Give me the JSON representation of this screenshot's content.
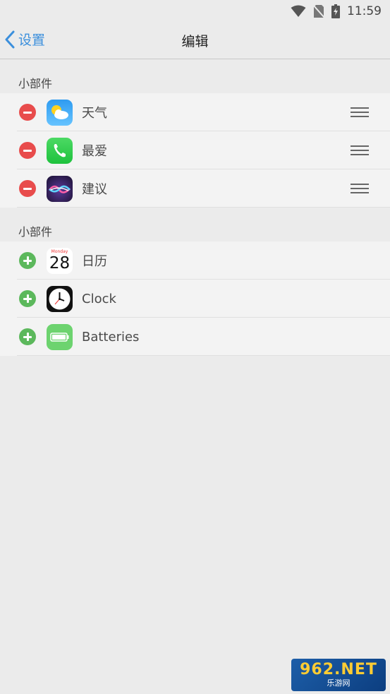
{
  "status_bar": {
    "time": "11:59"
  },
  "nav": {
    "back_label": "设置",
    "title": "编辑"
  },
  "sections": [
    {
      "header": "小部件",
      "items": [
        {
          "label": "天气",
          "icon": "weather-icon",
          "action": "remove"
        },
        {
          "label": "最爱",
          "icon": "phone-icon",
          "action": "remove"
        },
        {
          "label": "建议",
          "icon": "siri-icon",
          "action": "remove"
        }
      ]
    },
    {
      "header": "小部件",
      "items": [
        {
          "label": "日历",
          "icon": "calendar-icon",
          "action": "add",
          "calendar_day": "Monday",
          "calendar_date": "28"
        },
        {
          "label": "Clock",
          "icon": "clock-icon",
          "action": "add"
        },
        {
          "label": "Batteries",
          "icon": "battery-icon",
          "action": "add"
        }
      ]
    }
  ],
  "watermark": {
    "main": "962.NET",
    "sub": "乐游网"
  },
  "colors": {
    "accent": "#3b8fdc",
    "remove": "#e84c4c",
    "add": "#5cb85c"
  }
}
